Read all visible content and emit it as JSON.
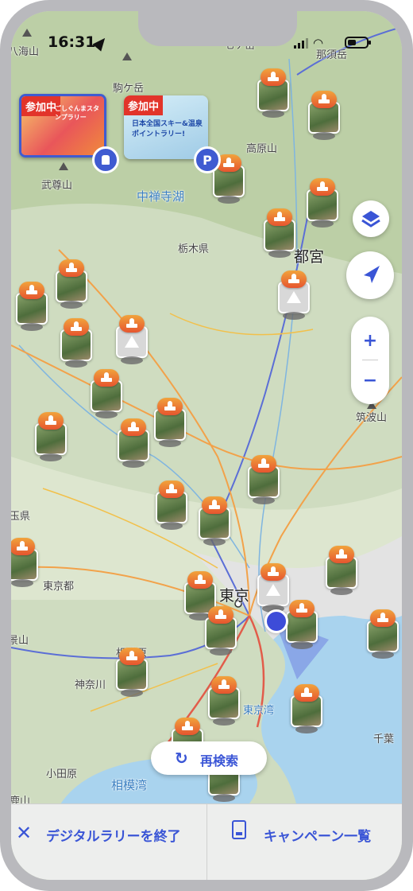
{
  "status_bar": {
    "time": "16:31"
  },
  "map": {
    "places": [
      {
        "label": "八海山",
        "cls": "place"
      },
      {
        "label": "七ケ岳",
        "cls": "place"
      },
      {
        "label": "那須岳",
        "cls": "place"
      },
      {
        "label": "駒ケ岳",
        "cls": "place"
      },
      {
        "label": "高原山",
        "cls": "place"
      },
      {
        "label": "武尊山",
        "cls": "place"
      },
      {
        "label": "中禅寺湖",
        "cls": "place water"
      },
      {
        "label": "栃木県",
        "cls": "place"
      },
      {
        "label": "都宮",
        "cls": "place big"
      },
      {
        "label": "筑波山",
        "cls": "place"
      },
      {
        "label": "玉県",
        "cls": "place"
      },
      {
        "label": "東京都",
        "cls": "place"
      },
      {
        "label": "東京",
        "cls": "place big"
      },
      {
        "label": "相模原",
        "cls": "place"
      },
      {
        "label": "東京湾",
        "cls": "place water"
      },
      {
        "label": "神奈川",
        "cls": "place"
      },
      {
        "label": "小田原",
        "cls": "place"
      },
      {
        "label": "相模湾",
        "cls": "place water"
      },
      {
        "label": "千葉",
        "cls": "place"
      },
      {
        "label": "鹿山",
        "cls": "place"
      },
      {
        "label": "景山",
        "cls": "place"
      }
    ]
  },
  "campaigns": [
    {
      "tag": "参加中",
      "caption": "ごしぐんまスタンプラリー"
    },
    {
      "tag": "参加中",
      "caption": "日本全国スキー&温泉ポイントラリー!"
    }
  ],
  "colors": {
    "accent": "#3a55d6",
    "badge_top": "#f1a33c",
    "badge_bottom": "#e6552f",
    "water": "#a9d3ee",
    "land": "#cfdcc0"
  },
  "controls": {
    "layers_icon": "layers-icon",
    "locate_icon": "navigation-arrow-icon",
    "zoom_in": "+",
    "zoom_out": "−",
    "parking_icon": "P"
  },
  "research_button": {
    "label": "再検索"
  },
  "bottom_bar": {
    "end_label": "デジタルラリーを終了",
    "list_label": "キャンペーン一覧"
  }
}
